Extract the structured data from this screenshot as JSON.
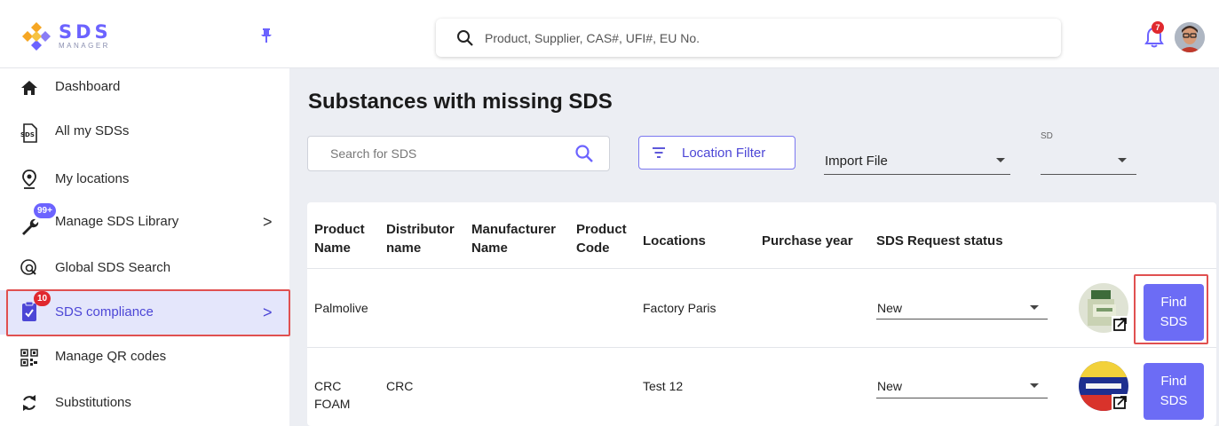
{
  "brand": {
    "name": "SDS",
    "tagline": "MANAGER"
  },
  "search": {
    "placeholder": "Product, Supplier, CAS#, UFI#, EU No."
  },
  "notifications": {
    "count": "7"
  },
  "sidebar": {
    "items": [
      {
        "label": "Dashboard",
        "icon": "home-icon"
      },
      {
        "label": "All my SDSs",
        "icon": "sds-file-icon"
      },
      {
        "label": "My locations",
        "icon": "location-pin-icon"
      },
      {
        "label": "Manage SDS Library",
        "icon": "wrench-icon",
        "badge": "99+",
        "chevron": ">"
      },
      {
        "label": "Global SDS Search",
        "icon": "global-search-icon"
      },
      {
        "label": "SDS compliance",
        "icon": "clipboard-check-icon",
        "badge": "10",
        "chevron": ">",
        "active": true
      },
      {
        "label": "Manage QR codes",
        "icon": "qr-code-icon"
      },
      {
        "label": "Substitutions",
        "icon": "swap-arrows-icon"
      }
    ]
  },
  "main": {
    "title": "Substances with missing SDS",
    "sds_search_placeholder": "Search for SDS",
    "location_filter_label": "Location Filter",
    "import_file_value": "Import File",
    "sds_select_label": "SD"
  },
  "table": {
    "headers": [
      [
        "Product",
        "Name"
      ],
      [
        "Distributor",
        "name"
      ],
      [
        "Manufacturer",
        "Name"
      ],
      [
        "Product",
        "Code"
      ],
      [
        "Locations"
      ],
      [
        "Purchase year"
      ],
      [
        "SDS Request status"
      ]
    ],
    "rows": [
      {
        "product_name": [
          "Palmolive"
        ],
        "distributor": "",
        "manufacturer": "",
        "product_code": "",
        "location": "Factory Paris",
        "purchase_year": "",
        "status": "New",
        "action": [
          "Find",
          "SDS"
        ]
      },
      {
        "product_name": [
          "CRC",
          "FOAM"
        ],
        "distributor": "CRC",
        "manufacturer": "",
        "product_code": "",
        "location": "Test 12",
        "purchase_year": "",
        "status": "New",
        "action": [
          "Find",
          "SDS"
        ]
      }
    ]
  },
  "colors": {
    "accent": "#6c6cf5",
    "badge": "#e0282e",
    "highlight": "#e05050",
    "active_bg": "#e4e6fb"
  }
}
